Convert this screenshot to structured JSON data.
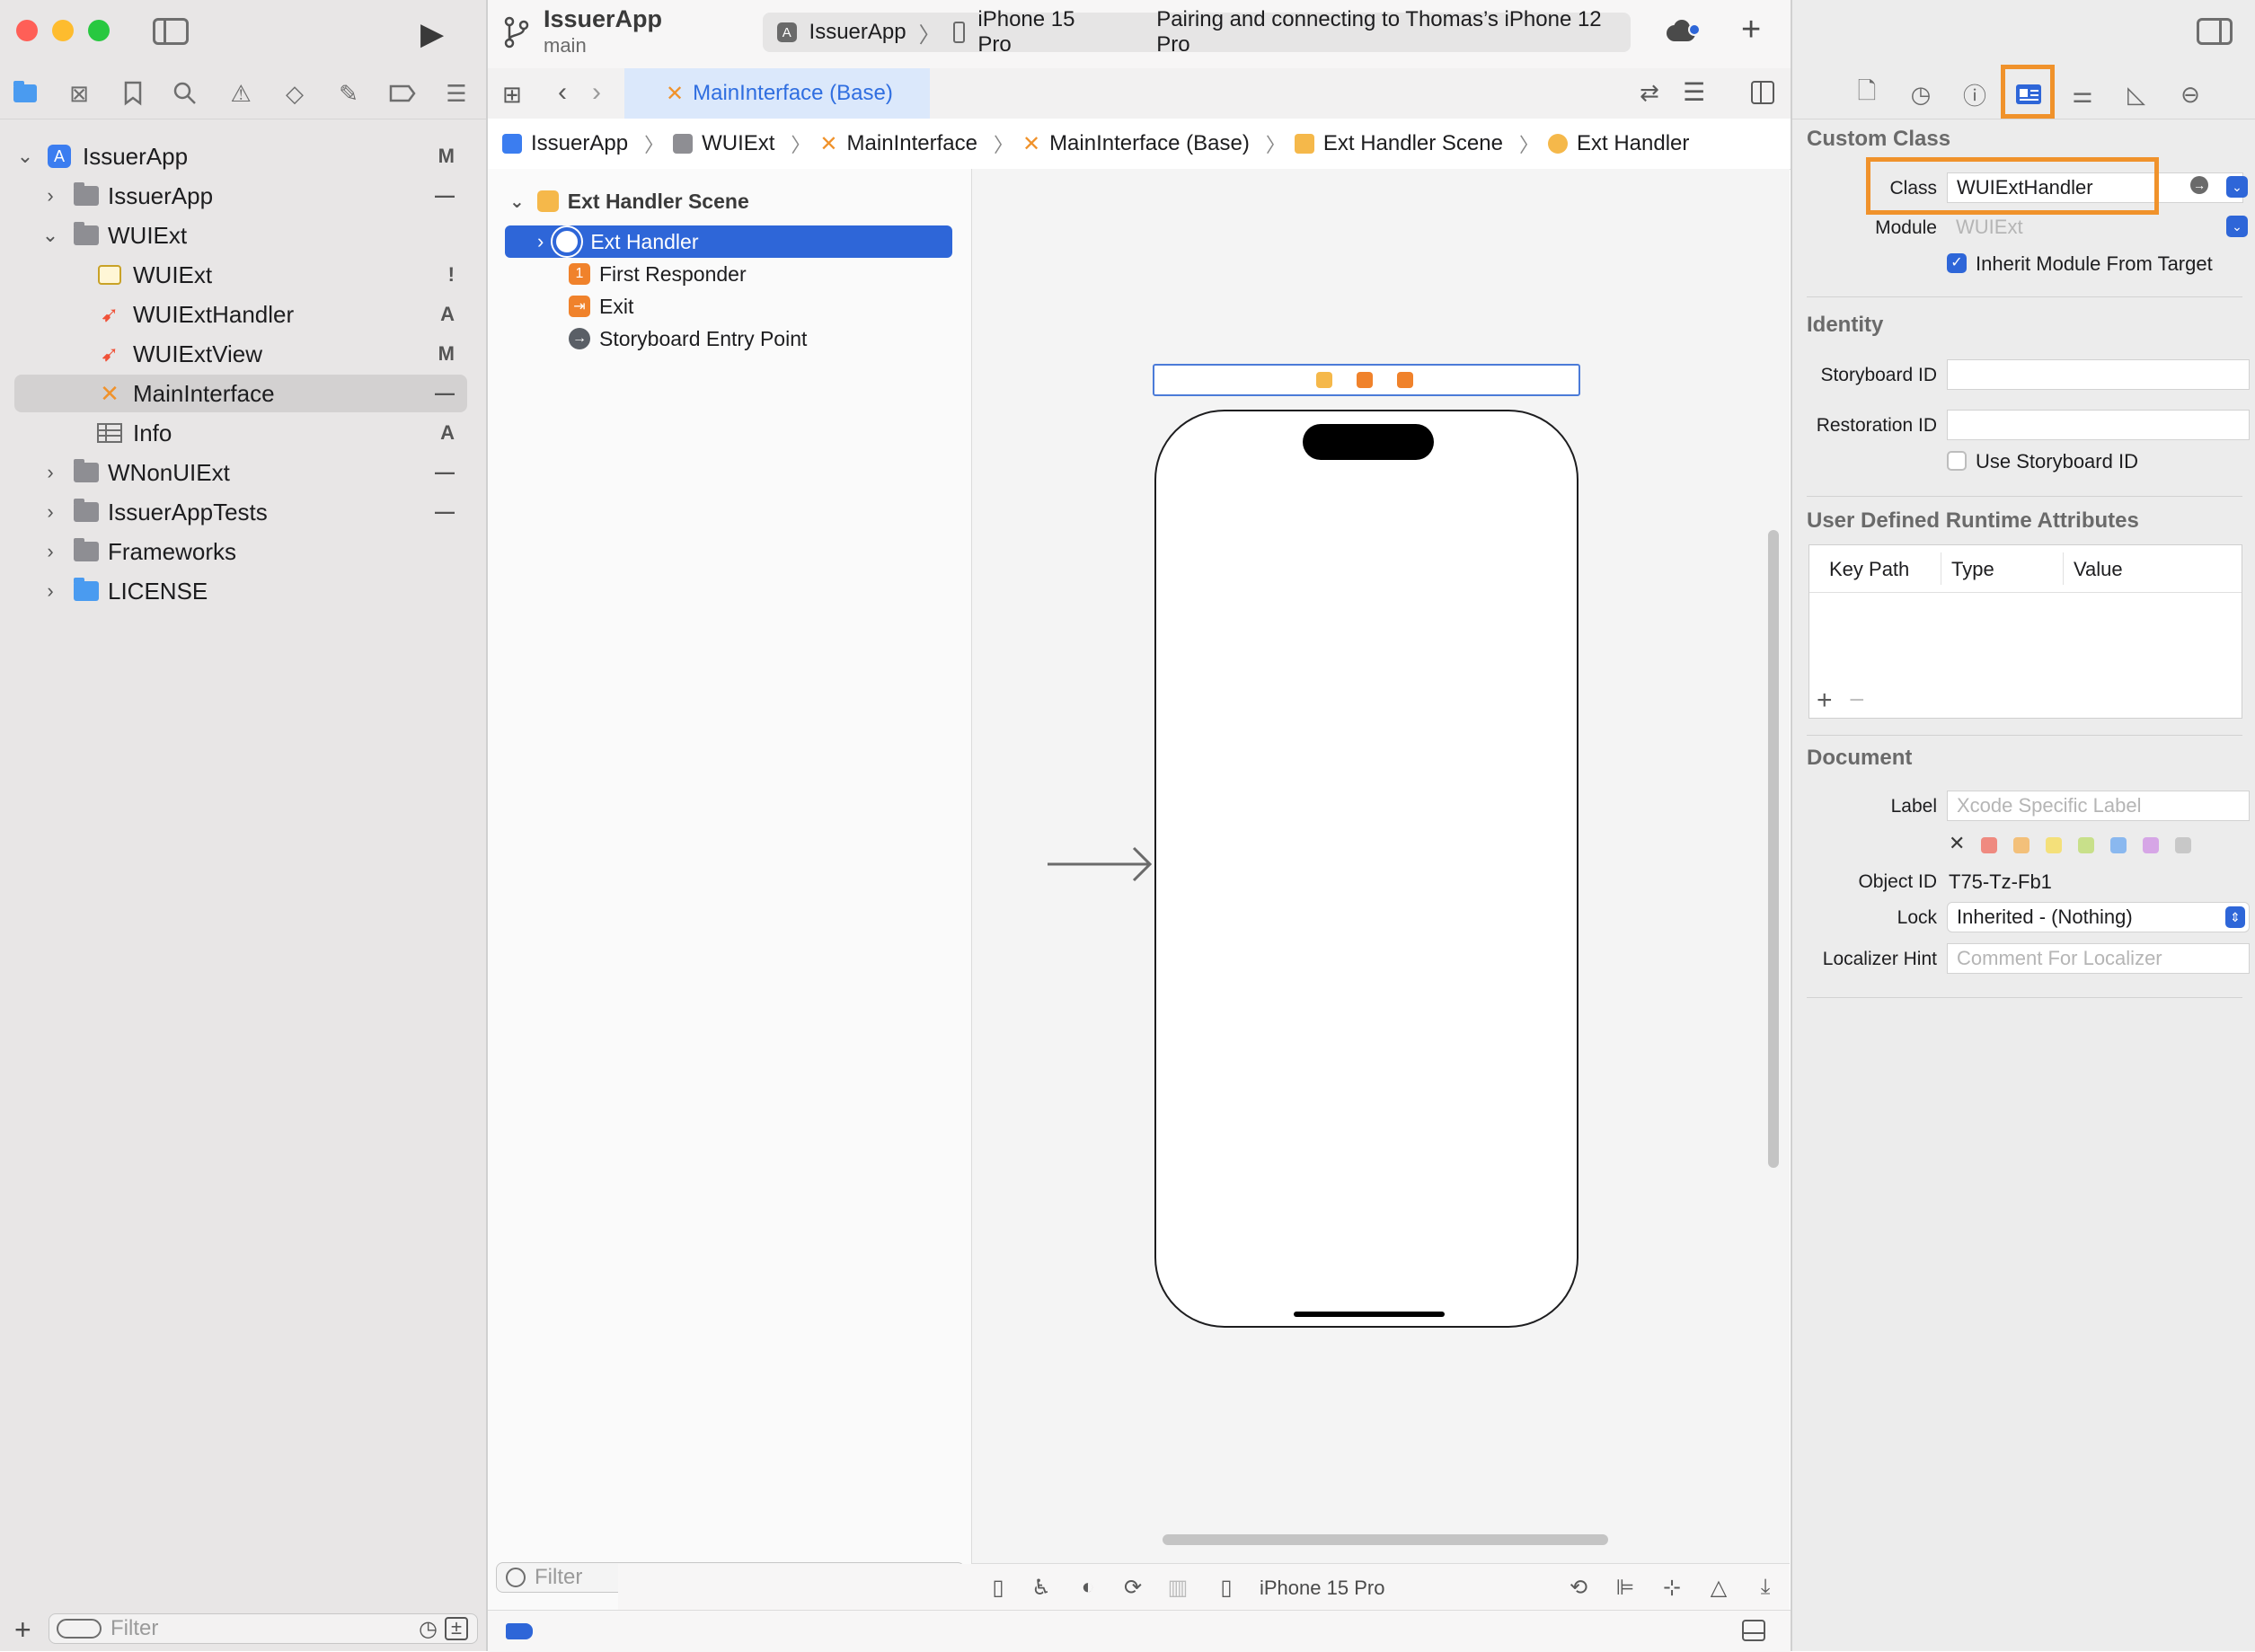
{
  "project": {
    "name": "IssuerApp",
    "branch": "main"
  },
  "scheme": {
    "target": "IssuerApp",
    "device": "iPhone 15 Pro",
    "status": "Pairing and connecting to Thomas’s iPhone 12 Pro"
  },
  "navigator": {
    "items": [
      {
        "label": "IssuerApp",
        "status": "M"
      },
      {
        "label": "IssuerApp",
        "status": "—"
      },
      {
        "label": "WUIExt",
        "status": ""
      },
      {
        "label": "WUIExt",
        "status": "!"
      },
      {
        "label": "WUIExtHandler",
        "status": "A"
      },
      {
        "label": "WUIExtView",
        "status": "M"
      },
      {
        "label": "MainInterface",
        "status": "—"
      },
      {
        "label": "Info",
        "status": "A"
      },
      {
        "label": "WNonUIExt",
        "status": "—"
      },
      {
        "label": "IssuerAppTests",
        "status": "—"
      },
      {
        "label": "Frameworks",
        "status": ""
      },
      {
        "label": "LICENSE",
        "status": ""
      }
    ],
    "filter_placeholder": "Filter"
  },
  "tab": {
    "label": "MainInterface (Base)"
  },
  "jumpbar": [
    "IssuerApp",
    "WUIExt",
    "MainInterface",
    "MainInterface (Base)",
    "Ext Handler Scene",
    "Ext Handler"
  ],
  "outline": {
    "scene": "Ext Handler Scene",
    "items": [
      "Ext Handler",
      "First Responder",
      "Exit",
      "Storyboard Entry Point"
    ],
    "filter_placeholder": "Filter"
  },
  "canvas": {
    "device_label": "iPhone 15 Pro"
  },
  "inspector": {
    "custom_class": {
      "title": "Custom Class",
      "class_label": "Class",
      "class_value": "WUIExtHandler",
      "module_label": "Module",
      "module_placeholder": "WUIExt",
      "inherit_label": "Inherit Module From Target"
    },
    "identity": {
      "title": "Identity",
      "storyboard_id_label": "Storyboard ID",
      "restoration_id_label": "Restoration ID",
      "use_storyboard_id_label": "Use Storyboard ID"
    },
    "runtime_attributes": {
      "title": "User Defined Runtime Attributes",
      "columns": [
        "Key Path",
        "Type",
        "Value"
      ]
    },
    "document": {
      "title": "Document",
      "label_label": "Label",
      "label_placeholder": "Xcode Specific Label",
      "object_id_label": "Object ID",
      "object_id_value": "T75-Tz-Fb1",
      "lock_label": "Lock",
      "lock_value": "Inherited - (Nothing)",
      "localizer_hint_label": "Localizer Hint",
      "localizer_hint_placeholder": "Comment For Localizer"
    }
  },
  "colors": {
    "accent": "#2e66d8",
    "highlight": "#f0922b",
    "swatches": [
      "#ef8a80",
      "#f3c07a",
      "#f4e07a",
      "#c8e08a",
      "#8ab8ef",
      "#d6a6e6",
      "#c8c8c8"
    ]
  }
}
